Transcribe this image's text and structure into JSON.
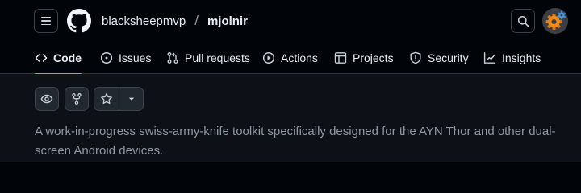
{
  "header": {
    "menu_icon": "hamburger-icon",
    "logo_icon": "github-mark-icon",
    "owner": "blacksheepmvp",
    "separator": "/",
    "repo": "mjolnir",
    "search_icon": "search-icon",
    "avatar_icon": "gear-avatar"
  },
  "tabs": [
    {
      "label": "Code",
      "icon": "code-icon",
      "selected": true
    },
    {
      "label": "Issues",
      "icon": "issue-opened-icon"
    },
    {
      "label": "Pull requests",
      "icon": "git-pull-request-icon"
    },
    {
      "label": "Actions",
      "icon": "play-icon"
    },
    {
      "label": "Projects",
      "icon": "table-icon"
    },
    {
      "label": "Security",
      "icon": "shield-icon"
    },
    {
      "label": "Insights",
      "icon": "graph-icon"
    }
  ],
  "actions": {
    "watch_icon": "eye-icon",
    "fork_icon": "repo-forked-icon",
    "star_icon": "star-icon",
    "star_menu_icon": "triangle-down-icon"
  },
  "description": "A work-in-progress swiss-army-knife toolkit specifically designed for the AYN Thor and other dual-screen Android devices.",
  "colors": {
    "header_bg": "#010409",
    "body_bg": "#0d1117",
    "tab_underline": "#f78166",
    "muted_text": "#9198a1"
  }
}
